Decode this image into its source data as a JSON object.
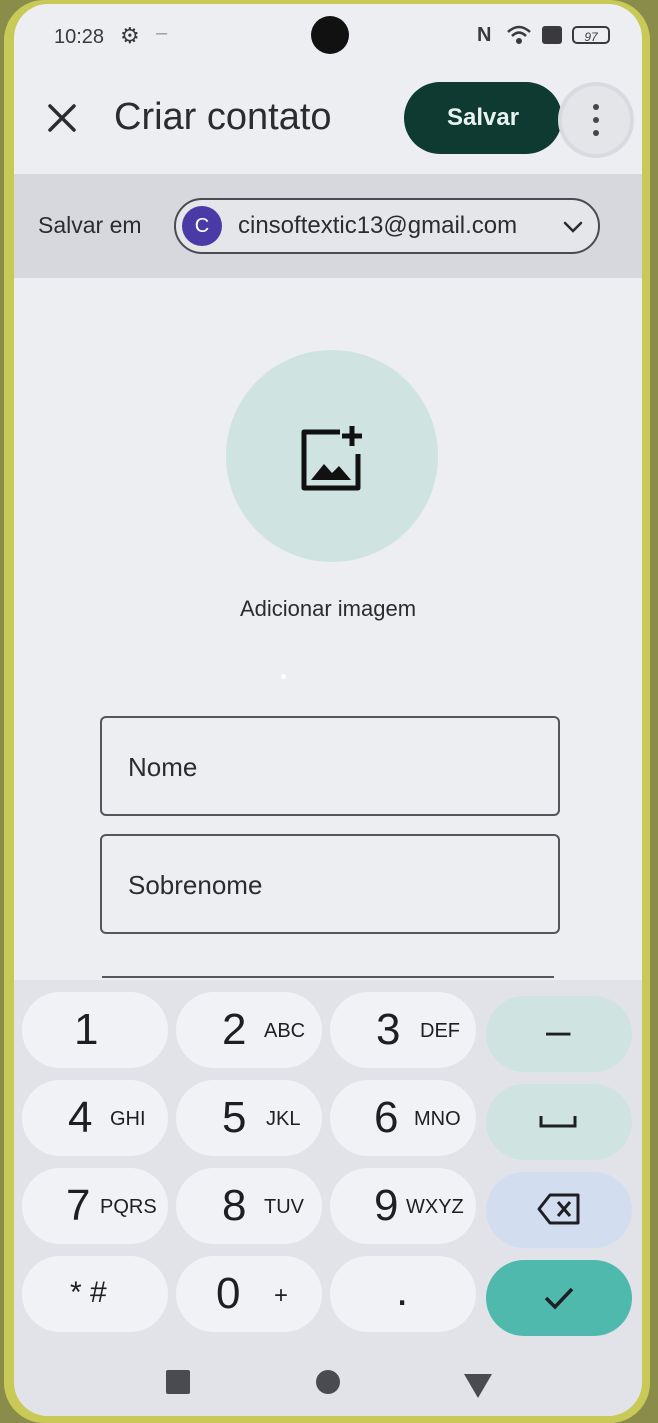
{
  "status": {
    "time": "10:28",
    "battery": "97",
    "nfc": "N"
  },
  "header": {
    "title": "Criar contato",
    "save_label": "Salvar"
  },
  "save_in": {
    "label": "Salvar em",
    "avatar_letter": "C",
    "account": "cinsoftextic13@gmail.com"
  },
  "photo": {
    "label": "Adicionar imagem"
  },
  "fields": {
    "first_name_placeholder": "Nome",
    "last_name_placeholder": "Sobrenome"
  },
  "keyboard": {
    "keys": [
      {
        "digit": "1",
        "letters": ""
      },
      {
        "digit": "2",
        "letters": "ABC"
      },
      {
        "digit": "3",
        "letters": "DEF"
      },
      {
        "digit": "4",
        "letters": "GHI"
      },
      {
        "digit": "5",
        "letters": "JKL"
      },
      {
        "digit": "6",
        "letters": "MNO"
      },
      {
        "digit": "7",
        "letters": "PQRS"
      },
      {
        "digit": "8",
        "letters": "TUV"
      },
      {
        "digit": "9",
        "letters": "WXYZ"
      },
      {
        "digit": "* #",
        "letters": ""
      },
      {
        "digit": "0",
        "letters": "+"
      },
      {
        "digit": ".",
        "letters": ""
      }
    ],
    "dash": "–",
    "space_icon": "space-icon",
    "backspace_icon": "backspace-icon",
    "done_icon": "checkmark-icon"
  },
  "colors": {
    "save_button": "#0e3a32",
    "photo_circle": "#cfe3e0",
    "done_key": "#4fb9ad",
    "avatar": "#4a3aa8"
  }
}
